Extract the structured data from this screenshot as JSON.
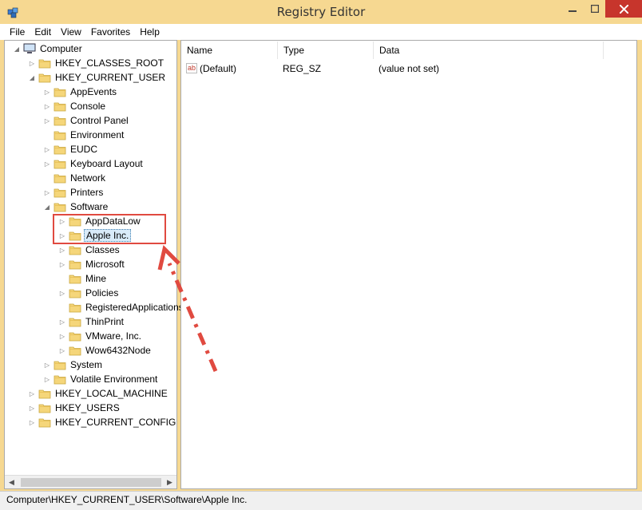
{
  "window": {
    "title": "Registry Editor"
  },
  "menu": [
    "File",
    "Edit",
    "View",
    "Favorites",
    "Help"
  ],
  "tree": {
    "root": "Computer",
    "hkcr": "HKEY_CLASSES_ROOT",
    "hkcu": "HKEY_CURRENT_USER",
    "hkcu_children": [
      "AppEvents",
      "Console",
      "Control Panel",
      "Environment",
      "EUDC",
      "Keyboard Layout",
      "Network",
      "Printers",
      "Software"
    ],
    "software_children": [
      "AppDataLow",
      "Apple Inc.",
      "Classes",
      "Microsoft",
      "Mine",
      "Policies",
      "RegisteredApplications",
      "ThinPrint",
      "VMware, Inc.",
      "Wow6432Node"
    ],
    "hkcu_after": [
      "System",
      "Volatile Environment"
    ],
    "hklm": "HKEY_LOCAL_MACHINE",
    "hku": "HKEY_USERS",
    "hkcc": "HKEY_CURRENT_CONFIG",
    "selected": "Apple Inc."
  },
  "list": {
    "columns": [
      "Name",
      "Type",
      "Data"
    ],
    "rows": [
      {
        "name": "(Default)",
        "type": "REG_SZ",
        "data": "(value not set)"
      }
    ]
  },
  "status": {
    "path": "Computer\\HKEY_CURRENT_USER\\Software\\Apple Inc."
  },
  "colors": {
    "titlebar": "#f6d891",
    "close": "#c7352c",
    "annotation": "#e04a40",
    "selection": "#d9ebf9"
  }
}
